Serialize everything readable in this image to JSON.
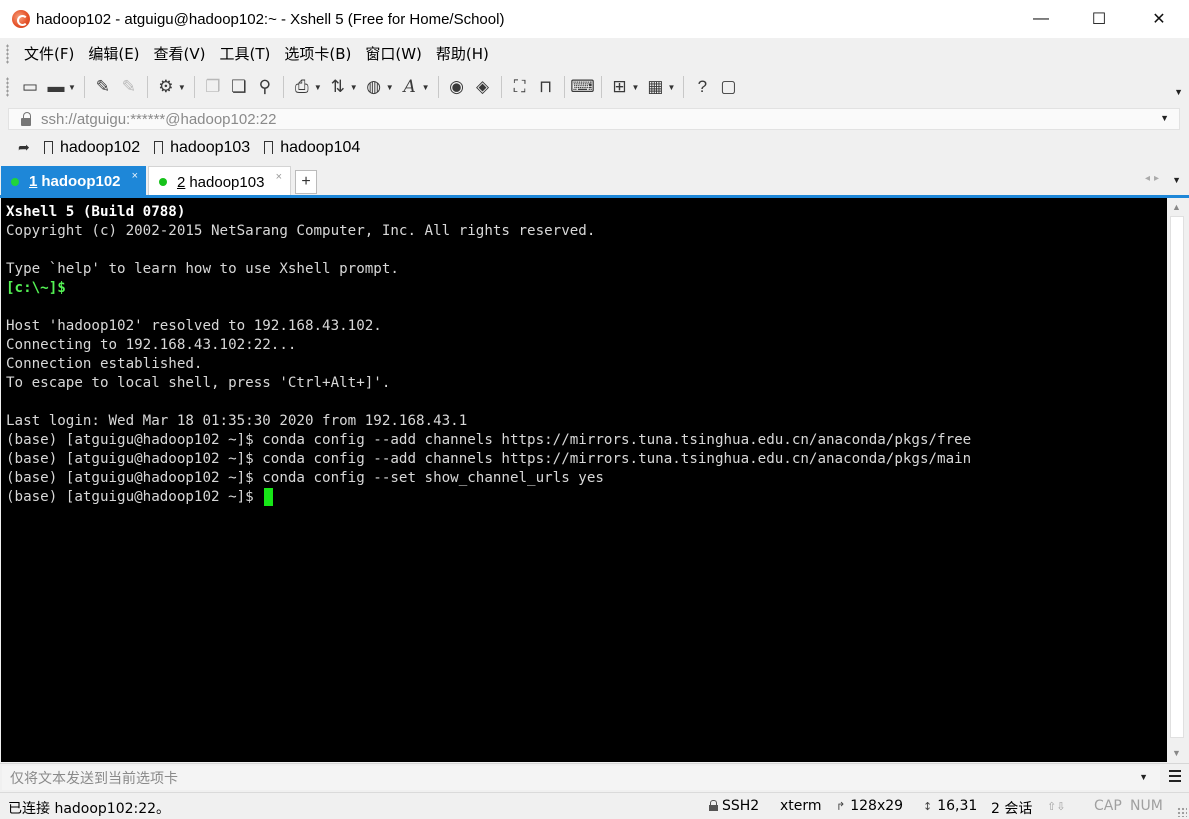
{
  "window": {
    "title": "hadoop102 - atguigu@hadoop102:~ - Xshell 5 (Free for Home/School)",
    "icon": "xshell-logo-icon",
    "controls": {
      "minimize": "—",
      "maximize": "☐",
      "close": "✕"
    }
  },
  "menubar": {
    "items": [
      {
        "label": "文件(F)"
      },
      {
        "label": "编辑(E)"
      },
      {
        "label": "查看(V)"
      },
      {
        "label": "工具(T)"
      },
      {
        "label": "选项卡(B)"
      },
      {
        "label": "窗口(W)"
      },
      {
        "label": "帮助(H)"
      }
    ]
  },
  "toolbar": {
    "icons": [
      "new-session-icon",
      "open-folder-icon",
      "connect-icon",
      "disconnect-icon",
      "properties-icon",
      "copy-icon",
      "paste-icon",
      "find-icon",
      "print-icon",
      "transfer-icon",
      "globe-icon",
      "font-icon",
      "xftp-icon",
      "xagent-icon",
      "fullscreen-icon",
      "lock-icon",
      "keyboard-icon",
      "add-tab-icon",
      "layout-icon",
      "help-icon",
      "chat-icon"
    ]
  },
  "address": {
    "value": "ssh://atguigu:******@hadoop102:22"
  },
  "links": {
    "items": [
      {
        "label": "hadoop102"
      },
      {
        "label": "hadoop103"
      },
      {
        "label": "hadoop104"
      }
    ]
  },
  "tabs": [
    {
      "number": "1",
      "label": "hadoop102",
      "status_color": "#21d43a",
      "active": true
    },
    {
      "number": "2",
      "label": "hadoop103",
      "status_color": "#16c21a",
      "active": false
    }
  ],
  "terminal": {
    "lines": [
      {
        "text": "Xshell 5 (Build 0788)",
        "style": "bold"
      },
      {
        "text": "Copyright (c) 2002-2015 NetSarang Computer, Inc. All rights reserved.",
        "style": "normal"
      },
      {
        "text": "",
        "style": "normal"
      },
      {
        "text": "Type `help' to learn how to use Xshell prompt.",
        "style": "normal"
      },
      {
        "text": "[c:\\~]$",
        "style": "green"
      },
      {
        "text": "",
        "style": "normal"
      },
      {
        "text": "Host 'hadoop102' resolved to 192.168.43.102.",
        "style": "normal"
      },
      {
        "text": "Connecting to 192.168.43.102:22...",
        "style": "normal"
      },
      {
        "text": "Connection established.",
        "style": "normal"
      },
      {
        "text": "To escape to local shell, press 'Ctrl+Alt+]'.",
        "style": "normal"
      },
      {
        "text": "",
        "style": "normal"
      },
      {
        "text": "Last login: Wed Mar 18 01:35:30 2020 from 192.168.43.1",
        "style": "normal"
      },
      {
        "text": "(base) [atguigu@hadoop102 ~]$ conda config --add channels https://mirrors.tuna.tsinghua.edu.cn/anaconda/pkgs/free",
        "style": "normal"
      },
      {
        "text": "(base) [atguigu@hadoop102 ~]$ conda config --add channels https://mirrors.tuna.tsinghua.edu.cn/anaconda/pkgs/main",
        "style": "normal"
      },
      {
        "text": "(base) [atguigu@hadoop102 ~]$ conda config --set show_channel_urls yes",
        "style": "normal"
      },
      {
        "text": "(base) [atguigu@hadoop102 ~]$ ",
        "style": "normal",
        "cursor": true
      }
    ],
    "cursor_color": "#17e617"
  },
  "compose": {
    "placeholder": "仅将文本发送到当前选项卡"
  },
  "status": {
    "connection": "已连接 hadoop102:22。",
    "protocol": "SSH2",
    "terminal_type": "xterm",
    "size": "128x29",
    "cursor_pos": "16,31",
    "sessions": "2 会话",
    "caps": "CAP",
    "num": "NUM"
  },
  "colors": {
    "accent": "#1e87d8",
    "terminal_bg": "#000000",
    "terminal_fg": "#d8d8d8",
    "prompt_green": "#54f254"
  }
}
